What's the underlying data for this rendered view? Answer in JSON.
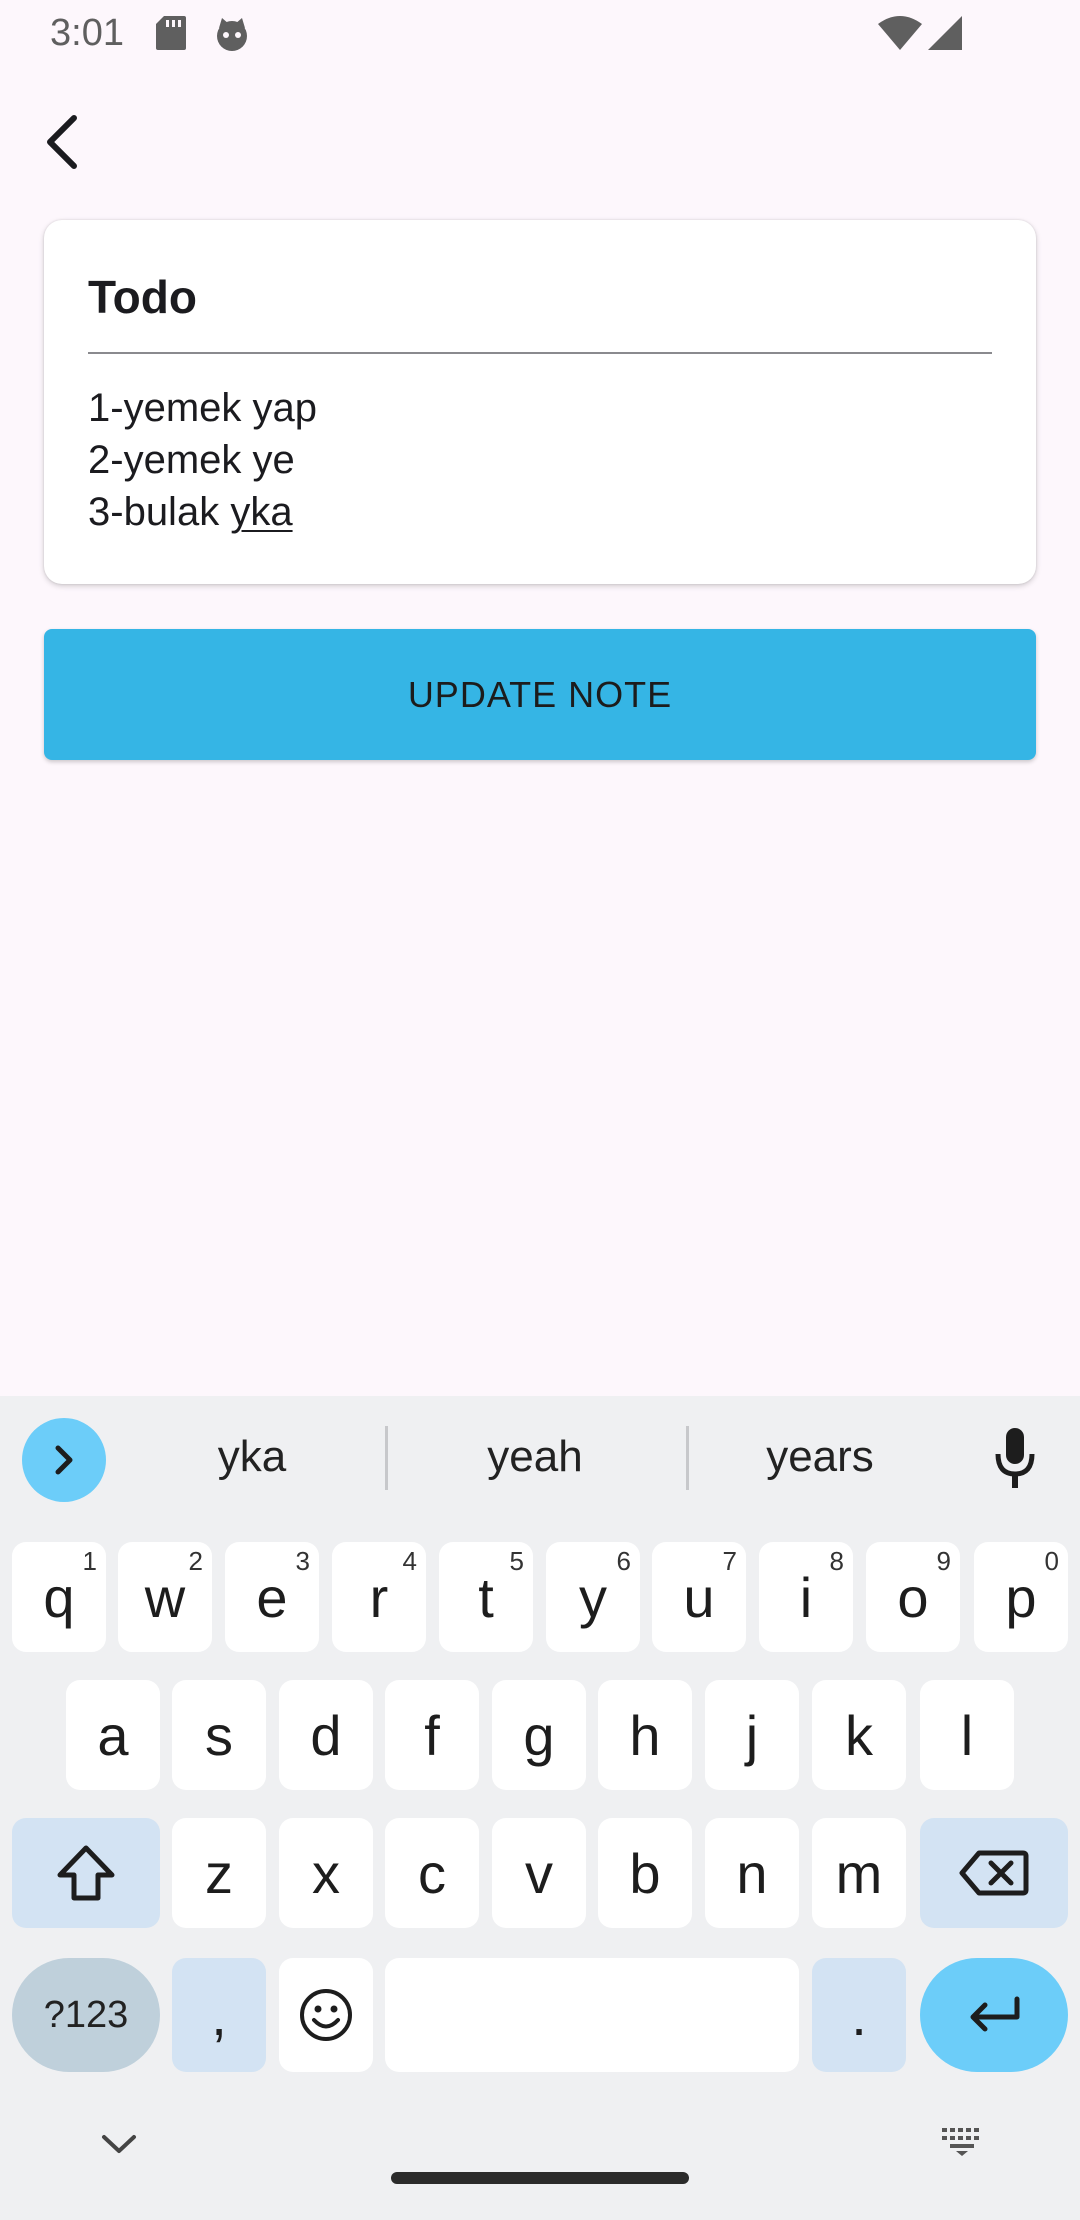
{
  "status_bar": {
    "time": "3:01"
  },
  "card": {
    "title": "Todo",
    "body_lines": [
      "1-yemek yap",
      "2-yemek ye",
      "3-bulak "
    ],
    "underlined_word": "yka"
  },
  "update_button": {
    "label": "UPDATE NOTE"
  },
  "keyboard": {
    "suggestions": [
      "yka",
      "yeah",
      "years"
    ],
    "row1": [
      {
        "k": "q",
        "s": "1"
      },
      {
        "k": "w",
        "s": "2"
      },
      {
        "k": "e",
        "s": "3"
      },
      {
        "k": "r",
        "s": "4"
      },
      {
        "k": "t",
        "s": "5"
      },
      {
        "k": "y",
        "s": "6"
      },
      {
        "k": "u",
        "s": "7"
      },
      {
        "k": "i",
        "s": "8"
      },
      {
        "k": "o",
        "s": "9"
      },
      {
        "k": "p",
        "s": "0"
      }
    ],
    "row2": [
      "a",
      "s",
      "d",
      "f",
      "g",
      "h",
      "j",
      "k",
      "l"
    ],
    "row3": [
      "z",
      "x",
      "c",
      "v",
      "b",
      "n",
      "m"
    ],
    "symbols_label": "?123",
    "comma_label": ",",
    "period_label": ".",
    "accent_color": "#6ccdf9",
    "function_key_color": "#d3e3f3"
  }
}
